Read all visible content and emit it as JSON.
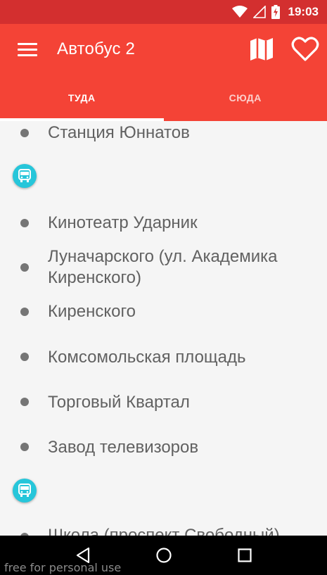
{
  "status_bar": {
    "time": "19:03",
    "icons": [
      "wifi-icon",
      "signal-icon",
      "battery-charging-icon"
    ]
  },
  "app_bar": {
    "title": "Автобус 2",
    "icons": [
      "menu-icon",
      "map-icon",
      "heart-icon"
    ]
  },
  "tabs": [
    {
      "label": "ТУДА",
      "active": true
    },
    {
      "label": "СЮДА",
      "active": false
    }
  ],
  "stops": [
    {
      "type": "stop",
      "name": "Станция Юннатов"
    },
    {
      "type": "bus"
    },
    {
      "type": "stop",
      "name": "Кинотеатр Ударник"
    },
    {
      "type": "stop",
      "name": "Луначарского (ул. Академика Киренского)"
    },
    {
      "type": "stop",
      "name": "Киренского"
    },
    {
      "type": "stop",
      "name": "Комсомольская площадь"
    },
    {
      "type": "stop",
      "name": "Торговый Квартал"
    },
    {
      "type": "stop",
      "name": "Завод телевизоров"
    },
    {
      "type": "bus"
    },
    {
      "type": "stop",
      "name": "Школа (проспект Свободный)"
    }
  ],
  "nav_bar": {
    "icons": [
      "back-icon",
      "home-icon",
      "recents-icon"
    ]
  },
  "watermark": "free for personal use",
  "colors": {
    "status_bar": "#d32f2f",
    "app_bar": "#f44336",
    "bus_marker": "#26c6da",
    "text": "#616161"
  }
}
